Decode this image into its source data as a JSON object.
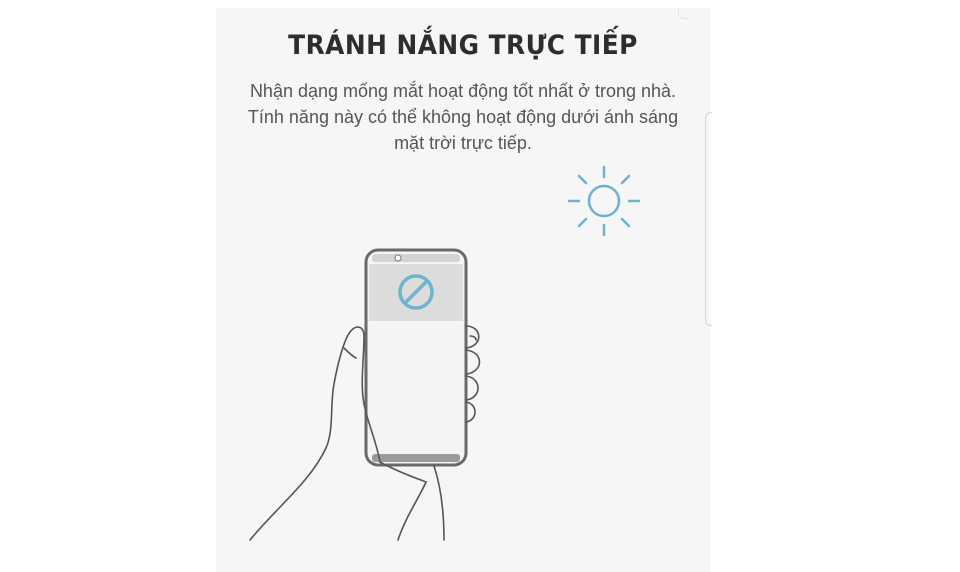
{
  "screen": {
    "title": "TRÁNH NẮNG TRỰC TIẾP",
    "description_lines": [
      "Nhận dạng mống mắt hoạt động tốt nhất ở trong nhà.",
      "Tính năng này có thể không hoạt động dưới ánh sáng",
      "mặt trời trực tiếp."
    ]
  },
  "icons": {
    "sun": "sun-icon",
    "prohibited": "prohibited-icon"
  },
  "colors": {
    "accent": "#6bb3cf",
    "title": "#2d2d2d",
    "text": "#555555",
    "panel": "#f6f6f6"
  }
}
